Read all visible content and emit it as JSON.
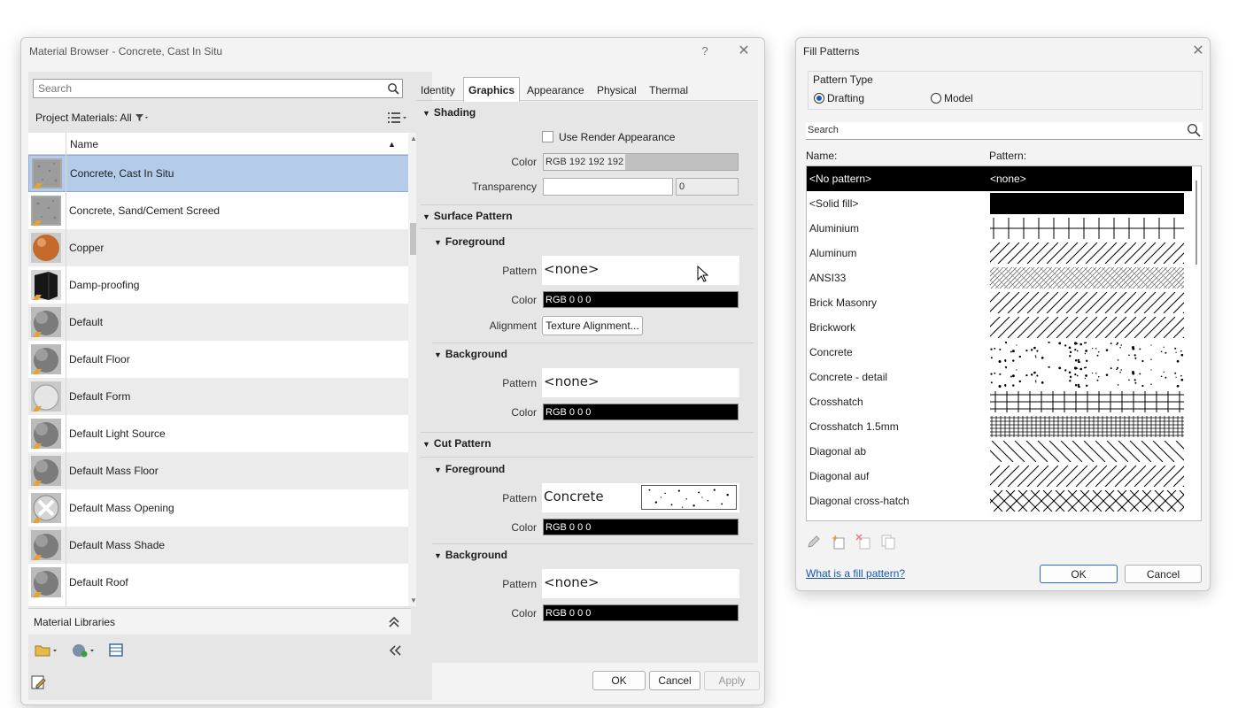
{
  "material_browser": {
    "title": "Material Browser - Concrete, Cast In Situ",
    "help": "?",
    "close": "✕",
    "search_placeholder": "Search",
    "project_materials": "Project Materials: All",
    "column_name": "Name",
    "materials": [
      {
        "name": "Concrete, Cast In Situ",
        "thumb": "concrete"
      },
      {
        "name": "Concrete, Sand/Cement Screed",
        "thumb": "concrete"
      },
      {
        "name": "Copper",
        "thumb": "copper"
      },
      {
        "name": "Damp-proofing",
        "thumb": "damp"
      },
      {
        "name": "Default",
        "thumb": "default"
      },
      {
        "name": "Default Floor",
        "thumb": "default"
      },
      {
        "name": "Default Form",
        "thumb": "form"
      },
      {
        "name": "Default Light Source",
        "thumb": "default"
      },
      {
        "name": "Default Mass Floor",
        "thumb": "default"
      },
      {
        "name": "Default Mass Opening",
        "thumb": "opening"
      },
      {
        "name": "Default Mass Shade",
        "thumb": "default"
      },
      {
        "name": "Default Roof",
        "thumb": "default"
      }
    ],
    "material_libraries": "Material Libraries",
    "tabs": [
      "Identity",
      "Graphics",
      "Appearance",
      "Physical",
      "Thermal"
    ],
    "active_tab": "Graphics",
    "shading": {
      "header": "Shading",
      "use_render": "Use Render Appearance",
      "color_label": "Color",
      "color_value": "RGB 192 192 192",
      "transparency_label": "Transparency",
      "transparency_value": "0"
    },
    "surface": {
      "header": "Surface Pattern",
      "fg": {
        "header": "Foreground",
        "pattern_label": "Pattern",
        "pattern_value": "<none>",
        "color_label": "Color",
        "color_value": "RGB 0 0 0",
        "alignment_label": "Alignment",
        "alignment_button": "Texture Alignment..."
      },
      "bg": {
        "header": "Background",
        "pattern_label": "Pattern",
        "pattern_value": "<none>",
        "color_label": "Color",
        "color_value": "RGB 0 0 0"
      }
    },
    "cut": {
      "header": "Cut Pattern",
      "fg": {
        "header": "Foreground",
        "pattern_label": "Pattern",
        "pattern_value": "Concrete",
        "color_label": "Color",
        "color_value": "RGB 0 0 0"
      },
      "bg": {
        "header": "Background",
        "pattern_label": "Pattern",
        "pattern_value": "<none>",
        "color_label": "Color",
        "color_value": "RGB 0 0 0"
      }
    },
    "buttons": {
      "ok": "OK",
      "cancel": "Cancel",
      "apply": "Apply"
    }
  },
  "fill_patterns": {
    "title": "Fill Patterns",
    "close": "✕",
    "pattern_type": "Pattern Type",
    "drafting": "Drafting",
    "model": "Model",
    "search_placeholder": "Search",
    "col_name": "Name:",
    "col_pattern": "Pattern:",
    "items": [
      {
        "name": "<No pattern>",
        "pattern": "none",
        "text": "<none>"
      },
      {
        "name": "<Solid fill>",
        "pattern": "solid"
      },
      {
        "name": "Aluminium",
        "pattern": "vert"
      },
      {
        "name": "Aluminum",
        "pattern": "diag"
      },
      {
        "name": "ANSI33",
        "pattern": "ansi"
      },
      {
        "name": "Brick Masonry",
        "pattern": "diag"
      },
      {
        "name": "Brickwork",
        "pattern": "diag"
      },
      {
        "name": "Concrete",
        "pattern": "dots"
      },
      {
        "name": "Concrete - detail",
        "pattern": "dots"
      },
      {
        "name": "Crosshatch",
        "pattern": "cross"
      },
      {
        "name": "Crosshatch 1.5mm",
        "pattern": "finecross"
      },
      {
        "name": "Diagonal ab",
        "pattern": "diagab"
      },
      {
        "name": "Diagonal auf",
        "pattern": "diag"
      },
      {
        "name": "Diagonal cross-hatch",
        "pattern": "diamond"
      }
    ],
    "help_link": "What is a fill pattern?",
    "ok": "OK",
    "cancel": "Cancel"
  }
}
